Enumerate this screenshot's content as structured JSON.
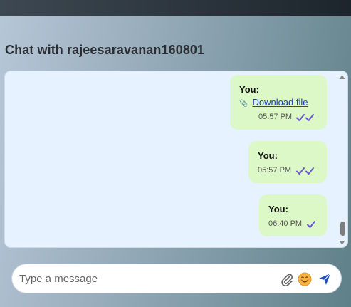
{
  "header": {
    "title": "Chat with rajeesaravanan160801"
  },
  "messages": [
    {
      "sender": "You:",
      "link_icon": "📎",
      "link_text": "Download file",
      "time": "05:57 PM",
      "status": "read"
    },
    {
      "sender": "You:",
      "time": "05:57 PM",
      "status": "read"
    },
    {
      "sender": "You:",
      "time": "06:40 PM",
      "status": "sent"
    }
  ],
  "composer": {
    "placeholder": "Type a message",
    "icons": [
      "paperclip-icon",
      "emoji-icon",
      "send-icon"
    ]
  },
  "colors": {
    "bubble": "#dcf8c6",
    "chat_background": "#e6f2ff",
    "tick": "#6a5acd",
    "link": "#1a3fc2",
    "send": "#1f4fbf"
  }
}
